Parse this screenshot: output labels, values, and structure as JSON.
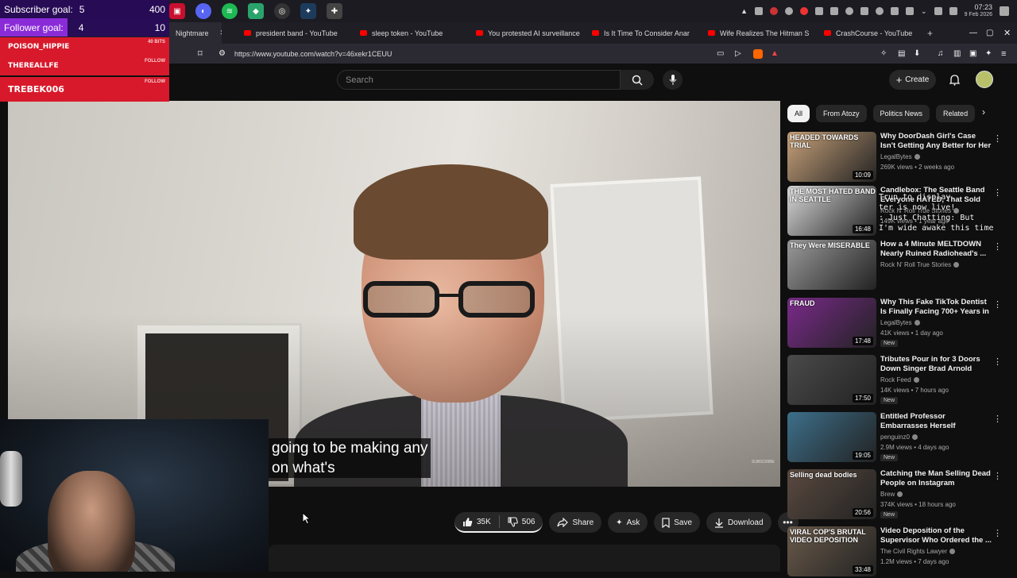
{
  "overlay": {
    "subscriber_goal_label": "Subscriber goal:",
    "subscriber_goal_current": "5",
    "subscriber_goal_target": "400",
    "follower_goal_label": "Follower goal:",
    "follower_goal_current": "4",
    "follower_goal_target": "10",
    "alerts": [
      {
        "name": "POISON_HIPPIE",
        "tag": "40 BITS"
      },
      {
        "name": "THEREALLFE",
        "tag": "FOLLOW"
      },
      {
        "name": "TREBEK006",
        "tag": "FOLLOW"
      }
    ]
  },
  "taskbar": {
    "time": "07:23",
    "date": "9 Feb 2026"
  },
  "browser": {
    "tabs": [
      {
        "title": "Nightmare"
      },
      {
        "title": "president band - YouTube"
      },
      {
        "title": "sleep token - YouTube"
      },
      {
        "title": "You protested AI surveillance"
      },
      {
        "title": "Is It Time To Consider Anar"
      },
      {
        "title": "Wife Realizes The Hitman S"
      },
      {
        "title": "CrashCourse - YouTube"
      }
    ],
    "url": "https://www.youtube.com/watch?v=46xekr1CEUU"
  },
  "youtube": {
    "search_placeholder": "Search",
    "create_label": "Create",
    "caption_line1": "going to be making any",
    "caption_line2": "on what's",
    "watermark": "SUBSCRIBE",
    "likes": "35K",
    "dislikes": "506",
    "share": "Share",
    "ask": "Ask",
    "save": "Save",
    "download": "Download",
    "chips": [
      "All",
      "From Atozy",
      "Politics News",
      "Related"
    ],
    "recommendations": [
      {
        "title": "Why DoorDash Girl's Case Isn't Getting Any Better for Her | ...",
        "channel": "LegalBytes",
        "meta": "269K views • 2 weeks ago",
        "duration": "10:09",
        "thumb_text": "HEADED TOWARDS TRIAL",
        "new": "",
        "color": "#c8a27a"
      },
      {
        "title": "Candlebox: The Seattle Band Everyone HATED, That Sold 4...",
        "channel": "Rock N' Roll True Stories",
        "meta": "149K views • 1 year ago",
        "duration": "16:48",
        "thumb_text": "THE MOST HATED BAND IN SEATTLE",
        "new": "",
        "color": "#d9d9d9"
      },
      {
        "title": "How a 4 Minute MELTDOWN Nearly Ruined Radiohead's ...",
        "channel": "Rock N' Roll True Stories",
        "meta": "",
        "duration": "",
        "thumb_text": "They Were MISERABLE",
        "new": "",
        "color": "#9a9a9a"
      },
      {
        "title": "Why This Fake TikTok Dentist Is Finally Facing 700+ Years in ...",
        "channel": "LegalBytes",
        "meta": "41K views • 1 day ago",
        "duration": "17:48",
        "thumb_text": "FRAUD",
        "new": "New",
        "color": "#7a2a8a"
      },
      {
        "title": "Tributes Pour in for 3 Doors Down Singer Brad Arnold",
        "channel": "Rock Feed",
        "meta": "14K views • 7 hours ago",
        "duration": "17:50",
        "thumb_text": "",
        "new": "New",
        "color": "#4a4a4a"
      },
      {
        "title": "Entitled Professor Embarrasses Herself",
        "channel": "penguinz0",
        "meta": "2.9M views • 4 days ago",
        "duration": "19:05",
        "thumb_text": "",
        "new": "New",
        "color": "#3d6f8a"
      },
      {
        "title": "Catching the Man Selling Dead People on Instagram",
        "channel": "Brew",
        "meta": "374K views • 18 hours ago",
        "duration": "20:56",
        "thumb_text": "Selling dead bodies",
        "new": "New",
        "color": "#5a4a40"
      },
      {
        "title": "Video Deposition of the Supervisor Who Ordered the ...",
        "channel": "The Civil Rights Lawyer",
        "meta": "1.2M views • 7 days ago",
        "duration": "33:48",
        "thumb_text": "VIRAL COP'S BRUTAL VIDEO DEPOSITION",
        "new": "",
        "color": "#6a5a4a"
      }
    ]
  },
  "terminal_overlay": "Trun to display\nter is now live!\n: Just Chatting: But\nI'm wide awake this time"
}
